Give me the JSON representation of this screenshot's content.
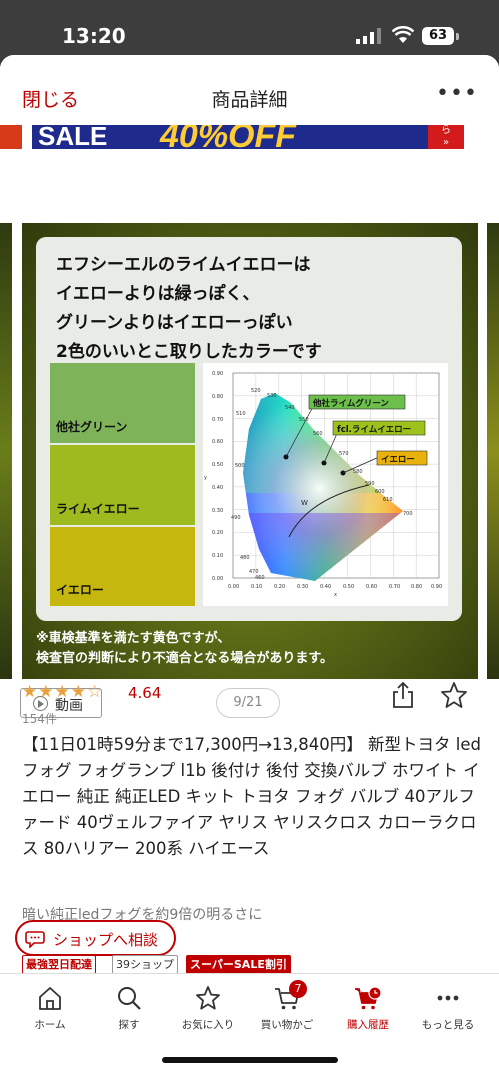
{
  "status_bar": {
    "time": "13:20",
    "battery": "63"
  },
  "navbar": {
    "close_label": "閉じる",
    "title": "商品詳細",
    "more_label": "•••"
  },
  "banner": {
    "sale_text": "SALE",
    "discount_text": "40%OFF",
    "right_text": "ら\n»"
  },
  "slide": {
    "headline_lines": [
      "エフシーエルのライムイエローは",
      "イエローよりは緑っぽく、",
      "グリーンよりはイエローっぽい",
      "2色のいいとこ取りしたカラーです"
    ],
    "swatches": [
      "他社グリーン",
      "ライムイエロー",
      "イエロー"
    ],
    "chart_labels": {
      "other_green": "他社ライムグリーン",
      "fcl_lime": "fcl.ライムイエロー",
      "yellow": "イエロー",
      "white_point": "W",
      "x_axis_symbol": "x",
      "y_axis_symbol": "y"
    },
    "wavelength_labels": [
      "520",
      "530",
      "540",
      "550",
      "560",
      "570",
      "580",
      "590",
      "600",
      "610",
      "700",
      "510",
      "500",
      "490",
      "480",
      "470",
      "460"
    ],
    "x_ticks": [
      "0.00",
      "0.10",
      "0.20",
      "0.30",
      "0.40",
      "0.50",
      "0.60",
      "0.70",
      "0.80",
      "0.90"
    ],
    "y_ticks": [
      "0.90",
      "0.80",
      "0.70",
      "0.60",
      "0.50",
      "0.40",
      "0.30",
      "0.20",
      "0.10",
      "0.00"
    ],
    "note_lines": [
      "※車検基準を満たす黄色ですが、",
      "検査官の判断により不適合となる場合があります。"
    ]
  },
  "gallery": {
    "video_label": "動画",
    "counter": "9/21"
  },
  "product": {
    "stars": "★★★★☆",
    "rating": "4.64",
    "review_count": "154件",
    "title": "【11日01時59分まで17,300円→13,840円】 新型トヨタ ledフォグ フォグランプ l1b 後付け 後付 交換バルブ ホワイト イエロー 純正 純正LED キット トヨタ フォグ バルブ 40アルファード 40ヴェルファイア ヤリス ヤリスクロス カローラクロス 80ハリアー 200系 ハイエース",
    "catch_copy": "暗い純正ledフォグを約9倍の明るさに",
    "shop_consult": "ショップへ相談",
    "tags": [
      "最強翌日配達",
      "39ショップ",
      "スーパーSALE割引"
    ]
  },
  "tabbar": {
    "items": [
      {
        "label": "ホーム",
        "icon": "home-icon"
      },
      {
        "label": "探す",
        "icon": "search-icon"
      },
      {
        "label": "お気に入り",
        "icon": "star-icon"
      },
      {
        "label": "買い物かご",
        "icon": "cart-icon",
        "badge": "7"
      },
      {
        "label": "購入履歴",
        "icon": "purchase-history-icon"
      },
      {
        "label": "もっと見る",
        "icon": "more-icon"
      }
    ]
  },
  "colors": {
    "accent": "#bf0000",
    "rating_star": "#e9a23b"
  }
}
